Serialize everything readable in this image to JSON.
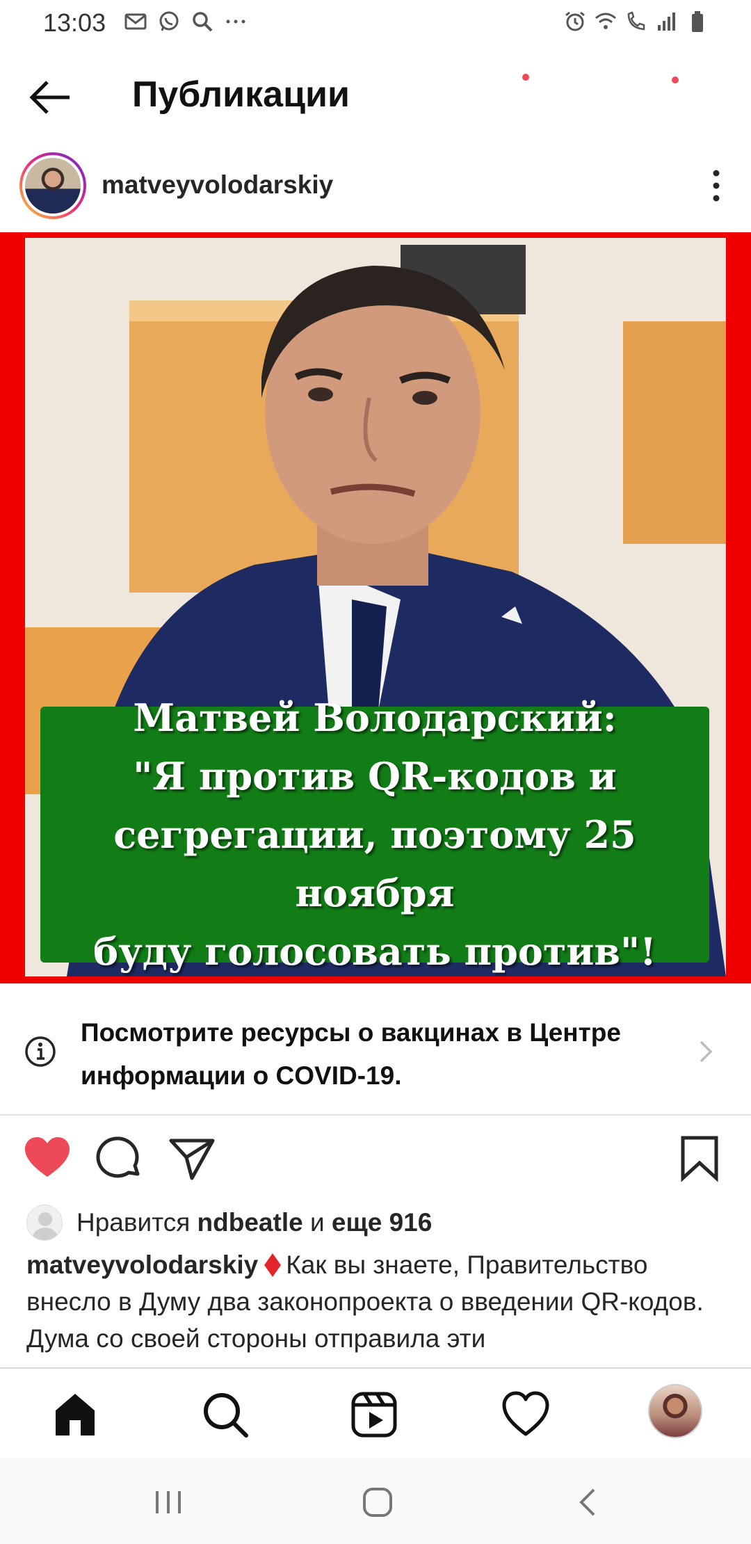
{
  "status_bar": {
    "time": "13:03",
    "left_icons": [
      "mail-icon",
      "whatsapp-icon",
      "search-icon",
      "more-dots-icon"
    ],
    "right_icons": [
      "alarm-icon",
      "wifi-icon",
      "volte-call-icon",
      "signal-icon",
      "battery-icon"
    ]
  },
  "header": {
    "title": "Публикации",
    "back_icon": "arrow-left-icon"
  },
  "post": {
    "username": "matveyvolodarskiy",
    "more_icon": "vertical-dots-icon",
    "image_quote": [
      "Матвей Володарский:",
      "\"Я против QR-кодов и",
      "сегрегации, поэтому 25 ноября",
      "буду голосовать против\"!"
    ],
    "covid_notice": "Посмотрите ресурсы о вакцинах в Центре информации о COVID-19.",
    "likes": {
      "prefix": "Нравится ",
      "user": "ndbeatle",
      "middle": " и ",
      "others": "еще 916"
    },
    "caption": {
      "username": "matveyvolodarskiy",
      "text": "Как вы знаете, Правительство внесло в Думу два законопроекта о введении QR-кодов. Дума со своей стороны отправила эти"
    }
  },
  "colors": {
    "like_red": "#ed4956",
    "frame_red": "#ef0000",
    "quote_green": "#127d17"
  },
  "bottom_nav": [
    "home-icon",
    "search-icon",
    "reels-icon",
    "activity-heart-icon",
    "profile-avatar"
  ],
  "system_nav": [
    "recents-icon",
    "home-circle-icon",
    "back-chevron-icon"
  ]
}
